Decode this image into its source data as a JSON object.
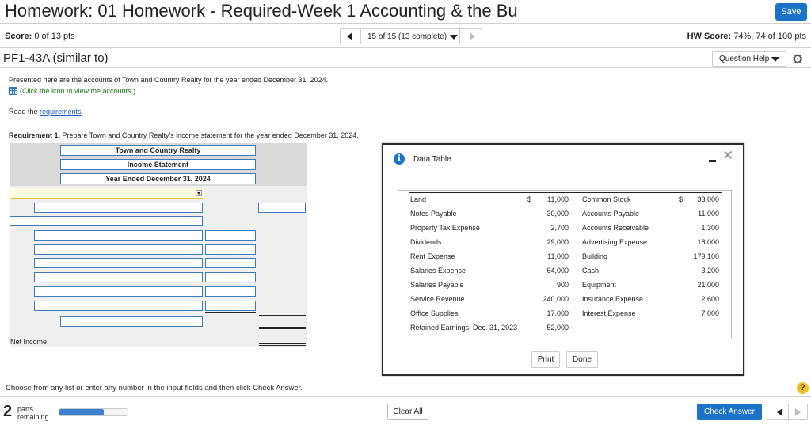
{
  "header": {
    "title": "Homework: 01 Homework - Required-Week 1 Accounting & the Bu",
    "save_label": "Save"
  },
  "score_row": {
    "score_label": "Score:",
    "score_value": "0 of 13 pts",
    "question_nav": "15 of 15 (13 complete)",
    "hw_score_label": "HW Score:",
    "hw_score_value": "74%, 74 of 100 pts"
  },
  "problem": {
    "id": "PF1-43A (similar to)",
    "question_help": "Question Help"
  },
  "content": {
    "intro": "Presented here are the accounts of Town and Country Realty for the year ended December 31, 2024.",
    "click_icon_text": "(Click the icon to view the accounts.)",
    "read_prefix": "Read the ",
    "requirements_link": "requirements",
    "read_suffix": ".",
    "req_label": "Requirement 1.",
    "req_text": " Prepare Town and Country Realty's income statement for the year ended December 31, 2024."
  },
  "statement": {
    "company": "Town and Country Realty",
    "title": "Income Statement",
    "period": "Year Ended December 31, 2024",
    "net_income_label": "Net Income"
  },
  "data_table": {
    "title": "Data Table",
    "rows": [
      {
        "a1": "Land",
        "cur1": "$",
        "v1": "11,000",
        "a2": "Common Stock",
        "cur2": "$",
        "v2": "33,000"
      },
      {
        "a1": "Notes Payable",
        "cur1": "",
        "v1": "30,000",
        "a2": "Accounts Payable",
        "cur2": "",
        "v2": "11,000"
      },
      {
        "a1": "Property Tax Expense",
        "cur1": "",
        "v1": "2,700",
        "a2": "Accounts Receivable",
        "cur2": "",
        "v2": "1,300"
      },
      {
        "a1": "Dividends",
        "cur1": "",
        "v1": "29,000",
        "a2": "Advertising Expense",
        "cur2": "",
        "v2": "18,000"
      },
      {
        "a1": "Rent Expense",
        "cur1": "",
        "v1": "11,000",
        "a2": "Building",
        "cur2": "",
        "v2": "179,100"
      },
      {
        "a1": "Salaries Expense",
        "cur1": "",
        "v1": "64,000",
        "a2": "Cash",
        "cur2": "",
        "v2": "3,200"
      },
      {
        "a1": "Salaries Payable",
        "cur1": "",
        "v1": "900",
        "a2": "Equipment",
        "cur2": "",
        "v2": "21,000"
      },
      {
        "a1": "Service Revenue",
        "cur1": "",
        "v1": "240,000",
        "a2": "Insurance Expense",
        "cur2": "",
        "v2": "2,600"
      },
      {
        "a1": "Office Supplies",
        "cur1": "",
        "v1": "17,000",
        "a2": "Interest Expense",
        "cur2": "",
        "v2": "7,000"
      },
      {
        "a1": "Retained Earnings, Dec. 31, 2023",
        "cur1": "",
        "v1": "52,000",
        "a2": "",
        "cur2": "",
        "v2": ""
      }
    ],
    "print_label": "Print",
    "done_label": "Done"
  },
  "footer": {
    "instruction": "Choose from any list or enter any number in the input fields and then click Check Answer.",
    "help_symbol": "?",
    "parts_count": "2",
    "parts_line1": "parts",
    "parts_line2": "remaining",
    "progress_fraction": 0.65,
    "clear_all": "Clear All",
    "check_answer": "Check Answer"
  },
  "colors": {
    "accent": "#1a73c9",
    "input_border": "#3a7abf",
    "help_badge": "#f0c020"
  }
}
